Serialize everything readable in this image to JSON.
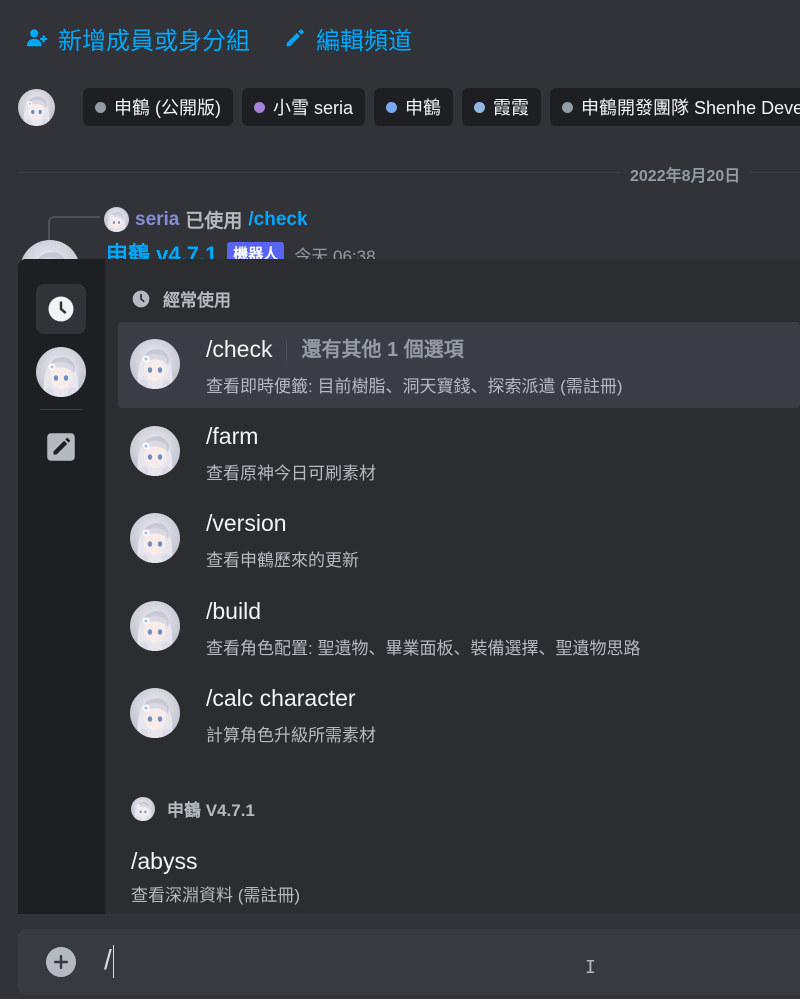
{
  "header": {
    "add_members_label": "新增成員或身分組",
    "edit_channel_label": "編輯頻道"
  },
  "threads": [
    {
      "label": "申鶴 (公開版)",
      "dot": "#949ba4"
    },
    {
      "label": "小雪 seria",
      "dot": "#a881e0"
    },
    {
      "label": "申鶴",
      "dot": "#7aa6f5"
    },
    {
      "label": "霞霞",
      "dot": "#8fb8e6"
    },
    {
      "label": "申鶴開發團隊 Shenhe Deve",
      "dot": "#949ba4"
    }
  ],
  "date_divider": "2022年8月20日",
  "reply": {
    "user": "seria",
    "used_text": "已使用",
    "command": "/check"
  },
  "message": {
    "author": "申鶴 v4.7.1",
    "badge": "機器人",
    "time": "今天 06:38"
  },
  "popup": {
    "frequent_heading": "經常使用",
    "frequent": [
      {
        "name": "/check",
        "extra": "還有其他 1 個選項",
        "desc": "查看即時便籤: 目前樹脂、洞天寶錢、探索派遣 (需註冊)"
      },
      {
        "name": "/farm",
        "extra": "",
        "desc": "查看原神今日可刷素材"
      },
      {
        "name": "/version",
        "extra": "",
        "desc": "查看申鶴歷來的更新"
      },
      {
        "name": "/build",
        "extra": "",
        "desc": "查看角色配置: 聖遺物、畢業面板、裝備選擇、聖遺物思路"
      },
      {
        "name": "/calc character",
        "extra": "",
        "desc": "計算角色升級所需素材"
      }
    ],
    "bot_heading": "申鶴 V4.7.1",
    "bot_commands": [
      {
        "name": "/abyss",
        "desc": "查看深淵資料 (需註冊)"
      }
    ]
  },
  "input": {
    "value": "/"
  },
  "icons": {
    "add_members": "person-add-icon",
    "edit_channel": "pencil-icon",
    "recent": "clock-icon",
    "bot": "bot-avatar",
    "other_apps": "pencil-square-icon",
    "attach": "plus-circle-icon"
  }
}
